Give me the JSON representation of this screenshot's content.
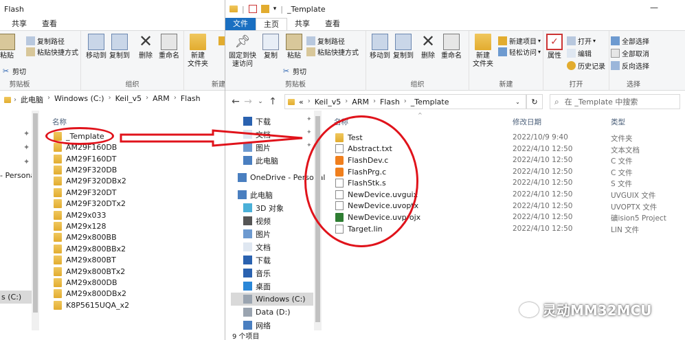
{
  "bg": {
    "title": "Flash",
    "tabs": [
      "共享",
      "查看"
    ],
    "ribbon": {
      "paste": "粘贴",
      "copy_path": "复制路径",
      "paste_shortcut": "粘贴快捷方式",
      "cut": "剪切",
      "clipboard": "剪贴板",
      "move_to": "移动到",
      "copy_to": "复制到",
      "delete": "删除",
      "rename": "重命名",
      "organize": "组织",
      "new_folder": "新建\n文件夹",
      "new_group_partial": "新",
      "new_partial": "新建"
    },
    "breadcrumb": [
      "此电脑",
      "Windows (C:)",
      "Keil_v5",
      "ARM",
      "Flash"
    ],
    "col_name": "名称",
    "side_label_personal": "- Personal",
    "side_label_drive": "s (C:)",
    "files": [
      "_Template",
      "AM29F160DB",
      "AM29F160DT",
      "AM29F320DB",
      "AM29F320DBx2",
      "AM29F320DT",
      "AM29F320DTx2",
      "AM29x033",
      "AM29x128",
      "AM29x800BB",
      "AM29x800BBx2",
      "AM29x800BT",
      "AM29x800BTx2",
      "AM29x800DB",
      "AM29x800DBx2",
      "K8P5615UQA_x2"
    ]
  },
  "fg": {
    "title": "_Template",
    "tabs": [
      "文件",
      "主页",
      "共享",
      "查看"
    ],
    "ribbon": {
      "pin": "固定到快\n速访问",
      "copy": "复制",
      "paste": "粘贴",
      "copy_path": "复制路径",
      "paste_shortcut": "粘贴快捷方式",
      "cut": "剪切",
      "clipboard": "剪贴板",
      "move_to": "移动到",
      "copy_to": "复制到",
      "delete": "删除",
      "rename": "重命名",
      "organize": "组织",
      "new_folder": "新建\n文件夹",
      "new_item": "新建项目",
      "easy_access": "轻松访问",
      "new": "新建",
      "properties": "属性",
      "open": "打开",
      "edit": "编辑",
      "history": "历史记录",
      "open_group": "打开",
      "select_all": "全部选择",
      "select_none": "全部取消",
      "invert": "反向选择",
      "select_group": "选择"
    },
    "breadcrumb": [
      "«",
      "Keil_v5",
      "ARM",
      "Flash",
      "_Template"
    ],
    "search_placeholder": "在 _Template 中搜索",
    "nav": {
      "quick": [
        {
          "label": "下载",
          "icon": "download-icon"
        },
        {
          "label": "文档",
          "icon": "document-icon"
        },
        {
          "label": "图片",
          "icon": "picture-icon"
        },
        {
          "label": "此电脑",
          "icon": "pc-icon"
        }
      ],
      "onedrive": "OneDrive - Personal",
      "this_pc": "此电脑",
      "pc_items": [
        {
          "label": "3D 对象",
          "icon": "3d-objects-icon"
        },
        {
          "label": "视频",
          "icon": "video-icon"
        },
        {
          "label": "图片",
          "icon": "picture-icon"
        },
        {
          "label": "文档",
          "icon": "document-icon"
        },
        {
          "label": "下载",
          "icon": "download-icon"
        },
        {
          "label": "音乐",
          "icon": "music-icon"
        },
        {
          "label": "桌面",
          "icon": "desktop-icon"
        },
        {
          "label": "Windows (C:)",
          "icon": "drive-icon"
        },
        {
          "label": "Data (D:)",
          "icon": "drive-icon"
        },
        {
          "label": "网络",
          "icon": "network-icon"
        }
      ]
    },
    "columns": {
      "name": "名称",
      "date": "修改日期",
      "type": "类型"
    },
    "files": [
      {
        "name": "Test",
        "date": "2022/10/9 9:40",
        "type": "文件夹",
        "icon": "folder"
      },
      {
        "name": "Abstract.txt",
        "date": "2022/4/10 12:50",
        "type": "文本文档",
        "icon": "txt"
      },
      {
        "name": "FlashDev.c",
        "date": "2022/4/10 12:50",
        "type": "C 文件",
        "icon": "sublime"
      },
      {
        "name": "FlashPrg.c",
        "date": "2022/4/10 12:50",
        "type": "C 文件",
        "icon": "sublime"
      },
      {
        "name": "FlashStk.s",
        "date": "2022/4/10 12:50",
        "type": "S 文件",
        "icon": "file"
      },
      {
        "name": "NewDevice.uvguix",
        "date": "2022/4/10 12:50",
        "type": "UVGUIX 文件",
        "icon": "file"
      },
      {
        "name": "NewDevice.uvoptx",
        "date": "2022/4/10 12:50",
        "type": "UVOPTX 文件",
        "icon": "file"
      },
      {
        "name": "NewDevice.uvprojx",
        "date": "2022/4/10 12:50",
        "type": "礦ision5 Project",
        "icon": "keil"
      },
      {
        "name": "Target.lin",
        "date": "2022/4/10 12:50",
        "type": "LIN 文件",
        "icon": "file"
      }
    ],
    "status": "9 个项目"
  },
  "watermark": "灵动MM32MCU",
  "colors": {
    "annotation_red": "#e0131b",
    "file_tab_blue": "#1a6fc1",
    "folder_yellow": "#e2ac2f"
  }
}
